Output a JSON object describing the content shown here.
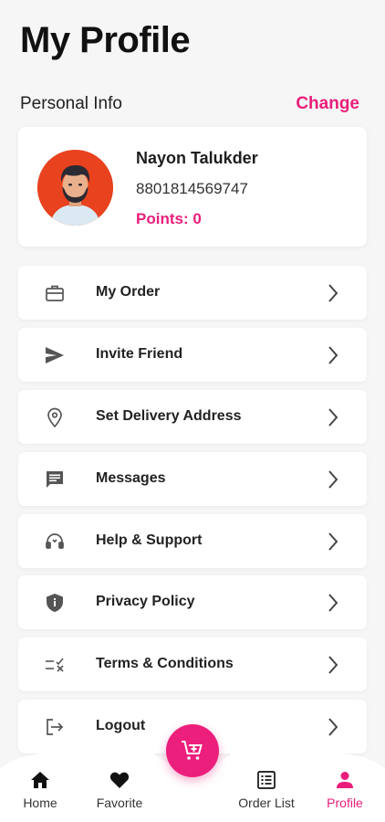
{
  "header": {
    "title": "My Profile"
  },
  "personal_info": {
    "label": "Personal Info",
    "change_label": "Change"
  },
  "profile": {
    "name": "Nayon Talukder",
    "phone": "8801814569747",
    "points": "Points: 0"
  },
  "menu": {
    "items": [
      {
        "label": "My Order",
        "icon": "briefcase-icon"
      },
      {
        "label": "Invite Friend",
        "icon": "send-icon"
      },
      {
        "label": "Set Delivery Address",
        "icon": "location-pin-icon"
      },
      {
        "label": "Messages",
        "icon": "message-icon"
      },
      {
        "label": "Help & Support",
        "icon": "support-icon"
      },
      {
        "label": "Privacy Policy",
        "icon": "shield-icon"
      },
      {
        "label": "Terms & Conditions",
        "icon": "terms-checklist-icon"
      },
      {
        "label": "Logout",
        "icon": "logout-icon"
      }
    ]
  },
  "bottom_nav": {
    "items": [
      {
        "label": "Home",
        "icon": "home-icon"
      },
      {
        "label": "Favorite",
        "icon": "heart-icon"
      },
      {
        "label": "Order List",
        "icon": "list-icon"
      },
      {
        "label": "Profile",
        "icon": "person-icon",
        "active": true
      }
    ],
    "fab_icon": "cart-add-icon"
  },
  "colors": {
    "accent": "#e91e7a",
    "background": "#f6f6f6",
    "avatar_bg": "#e8421e"
  }
}
